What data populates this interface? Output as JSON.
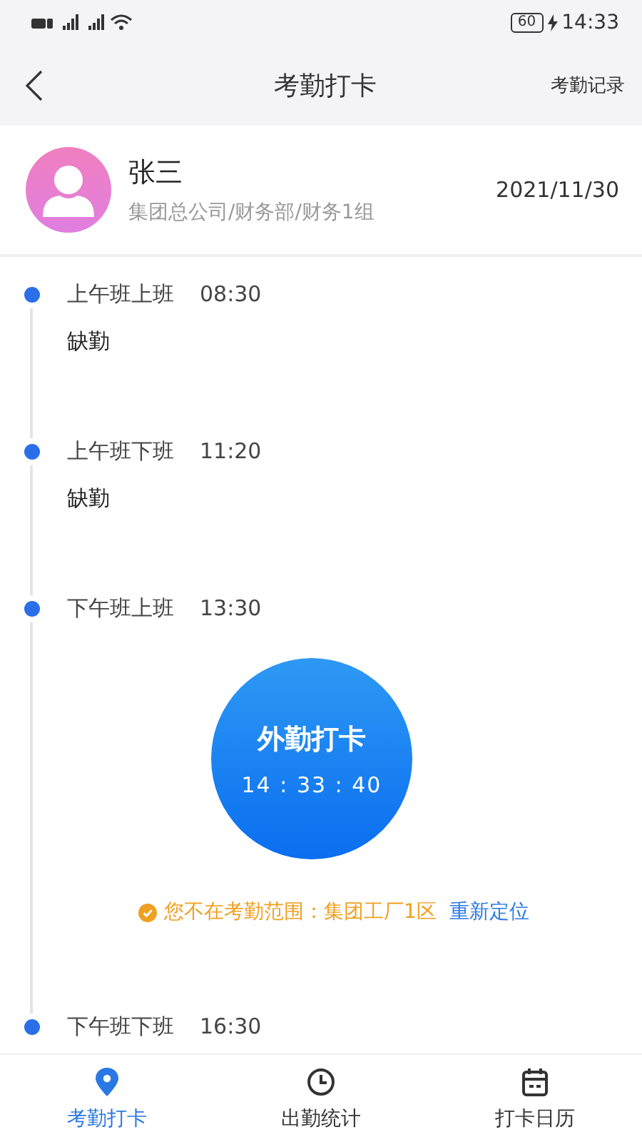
{
  "status_bar": {
    "battery": "60",
    "time": "14:33"
  },
  "header": {
    "title": "考勤打卡",
    "action": "考勤记录"
  },
  "profile": {
    "name": "张三",
    "department": "集团总公司/财务部/财务1组",
    "date": "2021/11/30"
  },
  "timeline": [
    {
      "kind": "status",
      "label": "上午班上班",
      "time": "08:30",
      "status": "缺勤"
    },
    {
      "kind": "status",
      "label": "上午班下班",
      "time": "11:20",
      "status": "缺勤"
    },
    {
      "kind": "punch",
      "label": "下午班上班",
      "time": "13:30",
      "punch": {
        "title": "外勤打卡",
        "clock": "14 : 33 : 40"
      },
      "notice": {
        "text": "您不在考勤范围：集团工厂1区",
        "action": "重新定位"
      }
    },
    {
      "kind": "plain",
      "label": "下午班下班",
      "time": "16:30"
    }
  ],
  "tabs": [
    {
      "label": "考勤打卡",
      "selected": true
    },
    {
      "label": "出勤统计",
      "selected": false
    },
    {
      "label": "打卡日历",
      "selected": false
    }
  ]
}
